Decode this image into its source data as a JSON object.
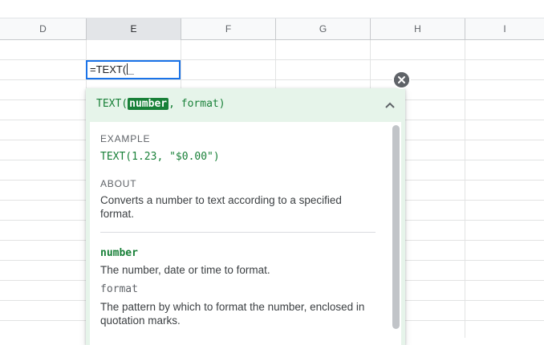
{
  "columns": [
    "D",
    "E",
    "F",
    "G",
    "H",
    "I"
  ],
  "selected_column": "E",
  "editor": {
    "text": "=TEXT("
  },
  "popup": {
    "signature": {
      "name": "TEXT(",
      "active_param": "number",
      "rest": ", format)"
    },
    "example": {
      "label": "EXAMPLE",
      "code": "TEXT(1.23, \"$0.00\")"
    },
    "about": {
      "label": "ABOUT",
      "text": "Converts a number to text according to a specified format."
    },
    "params": [
      {
        "name": "number",
        "description": "The number, date or time to format.",
        "active": true
      },
      {
        "name": "format",
        "description": "The pattern by which to format the number, enclosed in quotation marks.",
        "active": false
      }
    ]
  },
  "icons": {
    "close": "close-circle-icon",
    "collapse": "chevron-up-icon"
  },
  "colors": {
    "accent_green": "#188038",
    "popup_bg": "#e6f4ea",
    "selection_blue": "#1a73e8"
  }
}
